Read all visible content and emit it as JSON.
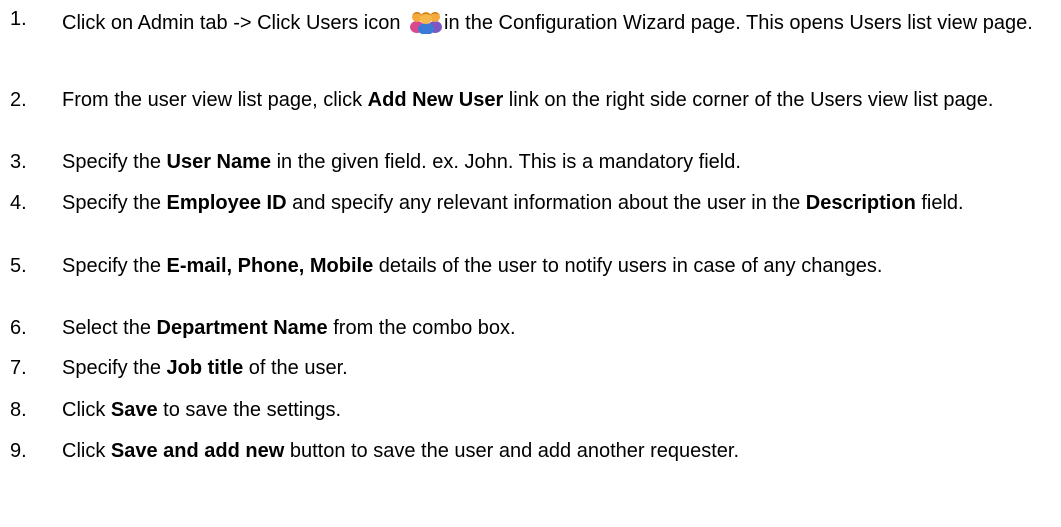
{
  "steps": [
    {
      "num": "1.",
      "t1": "Click on Admin tab -> Click Users icon ",
      "t2": "in the Configuration Wizard page. This opens Users list view page."
    },
    {
      "num": "2.",
      "t1": "From the user view list page, click ",
      "b1": "Add New User",
      "t2": " link on the right side corner of the Users view list page."
    },
    {
      "num": "3.",
      "t1": "Specify the ",
      "b1": "User Name",
      "t2": " in the given field. ex. John. This is a mandatory field."
    },
    {
      "num": "4.",
      "t1": "Specify the ",
      "b1": "Employee ID",
      "t2": " and specify any relevant information about the user in the ",
      "b2": "Description",
      "t3": " field."
    },
    {
      "num": "5.",
      "t1": "Specify the ",
      "b1": "E-mail, Phone, Mobile",
      "t2": " details of the user to notify users in case of any changes."
    },
    {
      "num": "6.",
      "t1": "Select the ",
      "b1": "Department Name",
      "t2": " from the combo box."
    },
    {
      "num": "7.",
      "t1": "Specify the ",
      "b1": "Job title",
      "t2": " of the user."
    },
    {
      "num": "8.",
      "t1": "Click ",
      "b1": "Save",
      "t2": " to save the settings."
    },
    {
      "num": "9.",
      "t1": "Click ",
      "b1": "Save and add new",
      "t2": " button to save the user and add another requester."
    }
  ],
  "icons": {
    "users": "users-group-icon"
  },
  "colors": {
    "text": "#000000",
    "background": "#ffffff",
    "icon_heads": "#f3a93b",
    "icon_body_center": "#3a7bd5",
    "icon_body_left": "#d94a8c",
    "icon_body_right": "#7e57c2"
  }
}
